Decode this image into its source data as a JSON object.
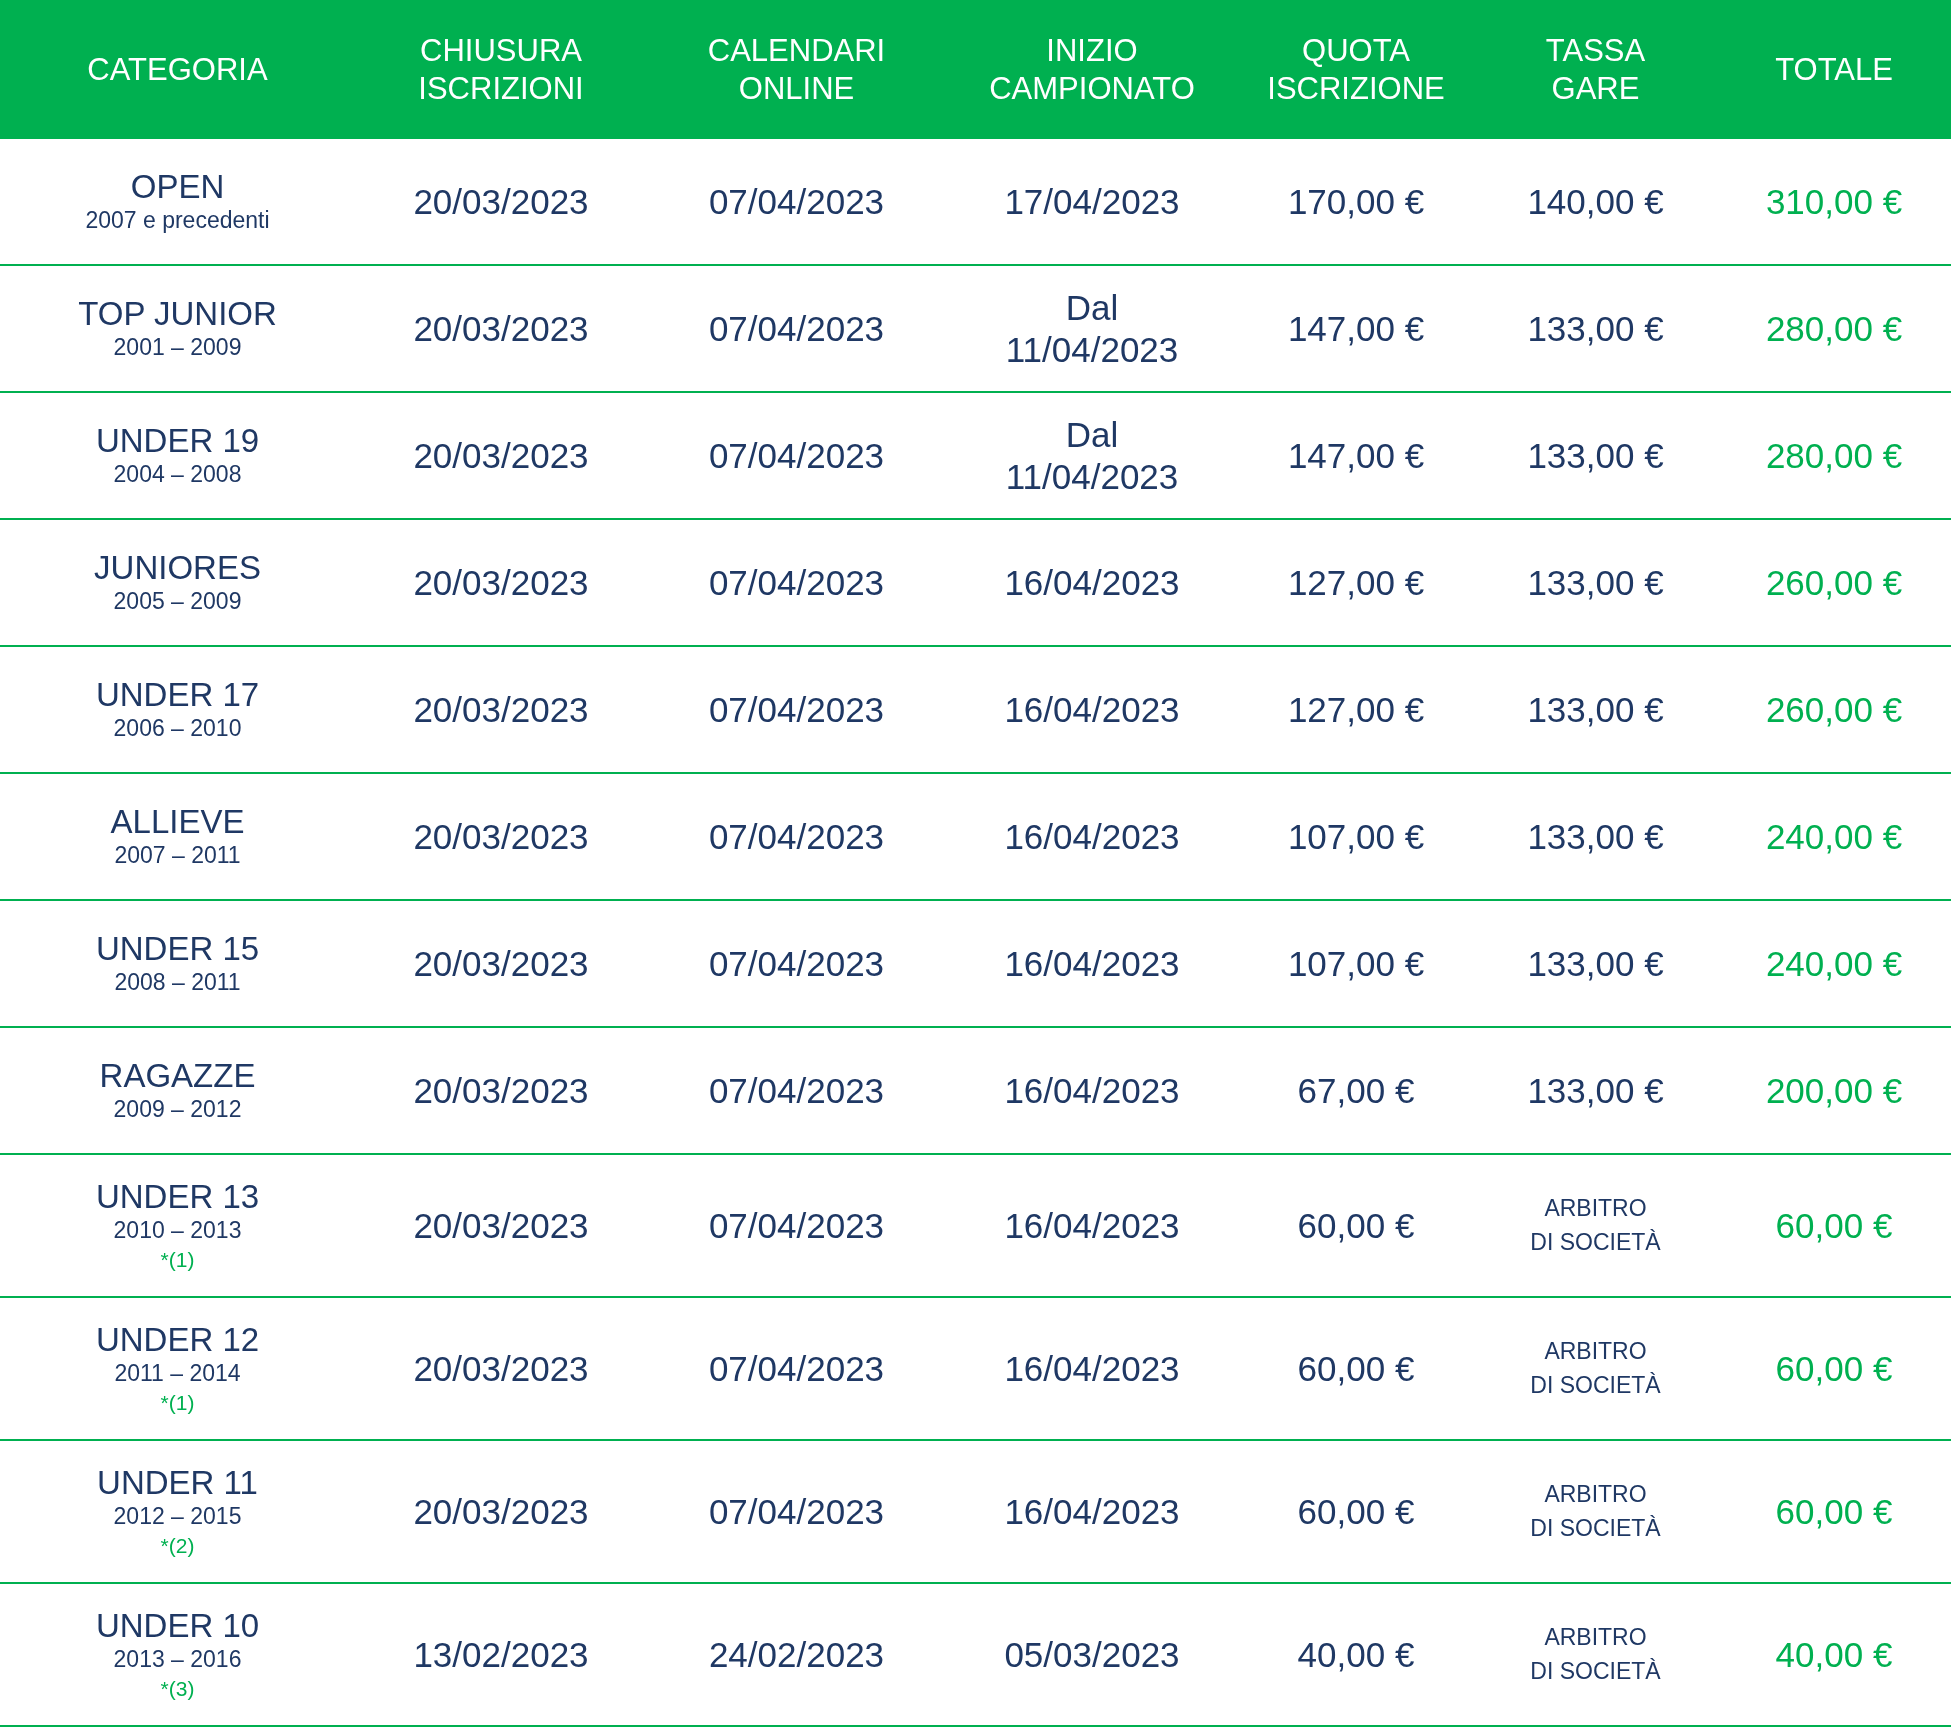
{
  "table": {
    "columns": [
      "CATEGORIA",
      "CHIUSURA\nISCRIZIONI",
      "CALENDARI\nONLINE",
      "INIZIO\nCAMPIONATO",
      "QUOTA\nISCRIZIONE",
      "TASSA\nGARE",
      "TOTALE"
    ],
    "rows": [
      {
        "category": "OPEN",
        "years": "2007 e precedenti",
        "closing": "20/03/2023",
        "calendars": "07/04/2023",
        "start": "17/04/2023",
        "fee": "170,00 €",
        "tax": {
          "kind": "amount",
          "text": "140,00 €"
        },
        "total": "310,00 €"
      },
      {
        "category": "TOP JUNIOR",
        "years": "2001 – 2009",
        "closing": "20/03/2023",
        "calendars": "07/04/2023",
        "start": "Dal\n11/04/2023",
        "fee": "147,00 €",
        "tax": {
          "kind": "amount",
          "text": "133,00 €"
        },
        "total": "280,00 €"
      },
      {
        "category": "UNDER 19",
        "years": "2004 – 2008",
        "closing": "20/03/2023",
        "calendars": "07/04/2023",
        "start": "Dal\n11/04/2023",
        "fee": "147,00 €",
        "tax": {
          "kind": "amount",
          "text": "133,00 €"
        },
        "total": "280,00 €"
      },
      {
        "category": "JUNIORES",
        "years": "2005 – 2009",
        "closing": "20/03/2023",
        "calendars": "07/04/2023",
        "start": "16/04/2023",
        "fee": "127,00 €",
        "tax": {
          "kind": "amount",
          "text": "133,00 €"
        },
        "total": "260,00 €"
      },
      {
        "category": "UNDER 17",
        "years": "2006 – 2010",
        "closing": "20/03/2023",
        "calendars": "07/04/2023",
        "start": "16/04/2023",
        "fee": "127,00 €",
        "tax": {
          "kind": "amount",
          "text": "133,00 €"
        },
        "total": "260,00 €"
      },
      {
        "category": "ALLIEVE",
        "years": "2007 – 2011",
        "closing": "20/03/2023",
        "calendars": "07/04/2023",
        "start": "16/04/2023",
        "fee": "107,00 €",
        "tax": {
          "kind": "amount",
          "text": "133,00 €"
        },
        "total": "240,00 €"
      },
      {
        "category": "UNDER 15",
        "years": "2008 – 2011",
        "closing": "20/03/2023",
        "calendars": "07/04/2023",
        "start": "16/04/2023",
        "fee": "107,00 €",
        "tax": {
          "kind": "amount",
          "text": "133,00 €"
        },
        "total": "240,00 €"
      },
      {
        "category": "RAGAZZE",
        "years": "2009 – 2012",
        "closing": "20/03/2023",
        "calendars": "07/04/2023",
        "start": "16/04/2023",
        "fee": "67,00 €",
        "tax": {
          "kind": "amount",
          "text": "133,00 €"
        },
        "total": "200,00 €"
      },
      {
        "category": "UNDER 13",
        "years": "2010 – 2013",
        "note": "*(1)",
        "closing": "20/03/2023",
        "calendars": "07/04/2023",
        "start": "16/04/2023",
        "fee": "60,00 €",
        "tax": {
          "kind": "note",
          "text": "ARBITRO\nDI SOCIETÀ"
        },
        "total": "60,00 €"
      },
      {
        "category": "UNDER 12",
        "years": "2011 – 2014",
        "note": "*(1)",
        "closing": "20/03/2023",
        "calendars": "07/04/2023",
        "start": "16/04/2023",
        "fee": "60,00 €",
        "tax": {
          "kind": "note",
          "text": "ARBITRO\nDI SOCIETÀ"
        },
        "total": "60,00 €"
      },
      {
        "category": "UNDER 11",
        "years": "2012 – 2015",
        "note": "*(2)",
        "closing": "20/03/2023",
        "calendars": "07/04/2023",
        "start": "16/04/2023",
        "fee": "60,00 €",
        "tax": {
          "kind": "note",
          "text": "ARBITRO\nDI SOCIETÀ"
        },
        "total": "60,00 €"
      },
      {
        "category": "UNDER 10",
        "years": "2013 – 2016",
        "note": "*(3)",
        "closing": "13/02/2023",
        "calendars": "24/02/2023",
        "start": "05/03/2023",
        "fee": "40,00 €",
        "tax": {
          "kind": "note",
          "text": "ARBITRO\nDI SOCIETÀ"
        },
        "total": "40,00 €"
      }
    ]
  }
}
